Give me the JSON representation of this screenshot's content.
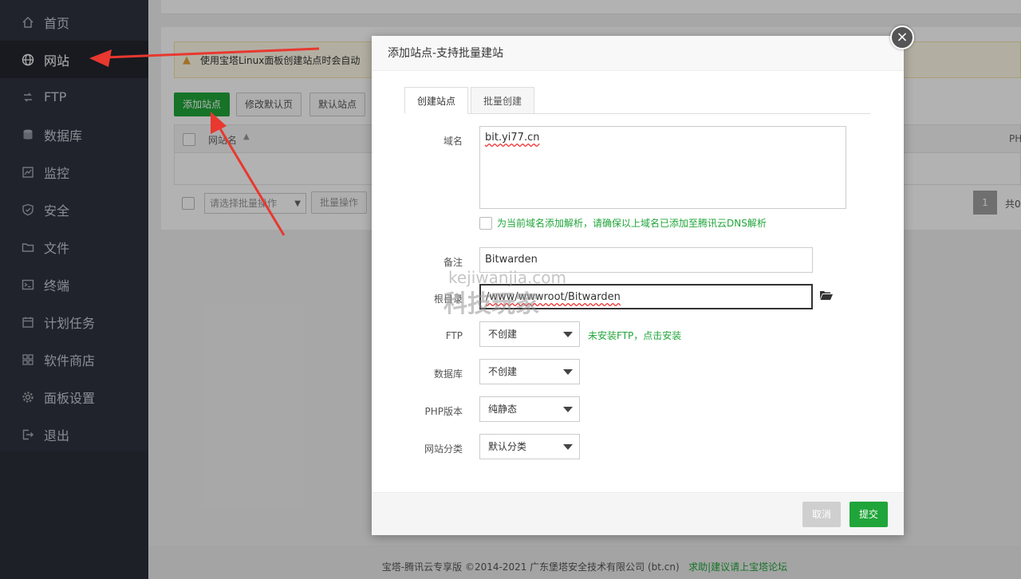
{
  "sidebar": {
    "items": [
      {
        "label": "首页",
        "icon": "home-icon"
      },
      {
        "label": "网站",
        "icon": "globe-icon",
        "active": true
      },
      {
        "label": "FTP",
        "icon": "ftp-icon"
      },
      {
        "label": "数据库",
        "icon": "database-icon"
      },
      {
        "label": "监控",
        "icon": "monitor-icon"
      },
      {
        "label": "安全",
        "icon": "shield-icon"
      },
      {
        "label": "文件",
        "icon": "folder-icon"
      },
      {
        "label": "终端",
        "icon": "terminal-icon"
      },
      {
        "label": "计划任务",
        "icon": "calendar-icon"
      },
      {
        "label": "软件商店",
        "icon": "grid-icon"
      },
      {
        "label": "面板设置",
        "icon": "gear-icon"
      },
      {
        "label": "退出",
        "icon": "logout-icon"
      }
    ]
  },
  "main": {
    "notice": "使用宝塔Linux面板创建站点时会自动",
    "toolbar": {
      "add_site": "添加站点",
      "edit_default_page": "修改默认页",
      "default_site": "默认站点"
    },
    "table": {
      "col_site_name": "网站名",
      "col_php": "PH"
    },
    "batch": {
      "select_placeholder": "请选择批量操作",
      "batch_button": "批量操作"
    },
    "pager": {
      "current": "1",
      "total_prefix": "共0"
    }
  },
  "footer": {
    "copyright": "宝塔-腾讯云专享版 ©2014-2021 广东堡塔安全技术有限公司 (bt.cn)",
    "help_link": "求助|建议请上宝塔论坛"
  },
  "modal": {
    "title": "添加站点-支持批量建站",
    "close": "×",
    "tabs": [
      "创建站点",
      "批量创建"
    ],
    "domain_label": "域名",
    "domain_value": "bit.yi77.cn",
    "dns_checkbox_label": "为当前域名添加解析，请确保以上域名已添加至腾讯云DNS解析",
    "remark_label": "备注",
    "remark_value": "Bitwarden",
    "root_label": "根目录",
    "root_value": "/www/wwwroot/Bitwarden",
    "ftp_label": "FTP",
    "ftp_value": "不创建",
    "ftp_hint": "未安装FTP，点击安装",
    "db_label": "数据库",
    "db_value": "不创建",
    "php_label": "PHP版本",
    "php_value": "纯静态",
    "category_label": "网站分类",
    "category_value": "默认分类",
    "cancel": "取消",
    "submit": "提交"
  },
  "watermark": {
    "line1": "kejiwanjia.com",
    "line2": "科技玩家"
  },
  "colors": {
    "accent": "#20a53a",
    "sidebar_bg": "#2f333e",
    "arrow": "#e8382f"
  }
}
